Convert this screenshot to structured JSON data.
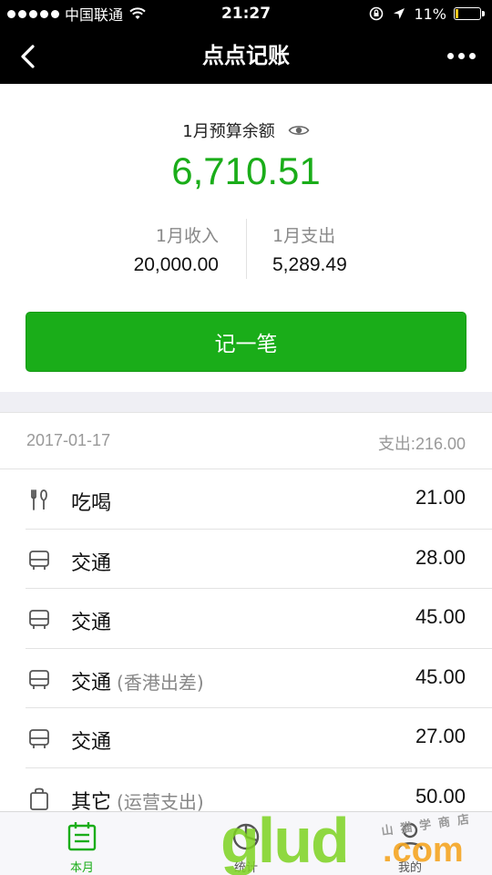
{
  "status_bar": {
    "carrier": "中国联通",
    "time": "21:27",
    "battery_text": "11%",
    "battery_level": 0.11
  },
  "nav": {
    "title": "点点记账"
  },
  "summary": {
    "budget_label": "1月预算余额",
    "budget_amount": "6,710.51",
    "income_label": "1月收入",
    "income_value": "20,000.00",
    "expense_label": "1月支出",
    "expense_value": "5,289.49",
    "record_button_label": "记一笔"
  },
  "transactions": {
    "date": "2017-01-17",
    "total": "支出:216.00",
    "items": [
      {
        "icon": "utensils-icon",
        "category": "吃喝",
        "note": "",
        "amount": "21.00"
      },
      {
        "icon": "bus-icon",
        "category": "交通",
        "note": "",
        "amount": "28.00"
      },
      {
        "icon": "bus-icon",
        "category": "交通",
        "note": "",
        "amount": "45.00"
      },
      {
        "icon": "bus-icon",
        "category": "交通",
        "note": "(香港出差)",
        "amount": "45.00"
      },
      {
        "icon": "bus-icon",
        "category": "交通",
        "note": "",
        "amount": "27.00"
      },
      {
        "icon": "bag-icon",
        "category": "其它",
        "note": "(运营支出)",
        "amount": "50.00"
      }
    ]
  },
  "tabs": [
    {
      "label": "本月",
      "icon": "calendar-icon",
      "active": true
    },
    {
      "label": "统计",
      "icon": "pie-chart-icon",
      "active": false
    },
    {
      "label": "我的",
      "icon": "person-icon",
      "active": false
    }
  ],
  "watermark": {
    "brand": "glud",
    "domain": ".com",
    "tagline": "山猫学商店"
  },
  "colors": {
    "accent": "#1aad19",
    "nav_bg": "#000000",
    "page_bg": "#efeff4"
  }
}
